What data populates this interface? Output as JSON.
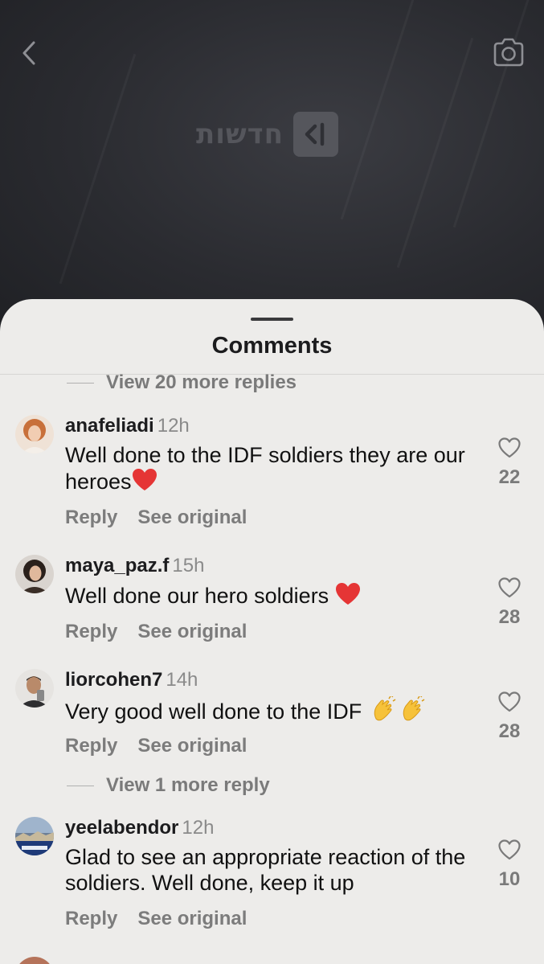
{
  "sheet": {
    "title": "Comments",
    "view_more_top": "View 20 more replies",
    "view_more_mid": "View 1 more reply"
  },
  "logo": {
    "text": "חדשות"
  },
  "colors": {
    "sheet_bg": "#edecea",
    "heart_red": "#e53535",
    "video_bg": "#2b2c31"
  },
  "icons": {
    "back": "chevron-left-icon",
    "camera": "camera-icon",
    "like": "heart-outline-icon"
  },
  "comments": [
    {
      "username": "anafeliadi",
      "time": "12h",
      "text": "Well done to the IDF soldiers they are our heroes",
      "likes": "22",
      "reply": "Reply",
      "see_original": "See original"
    },
    {
      "username": "maya_paz.f",
      "time": "15h",
      "text": "Well done our hero soldiers ",
      "likes": "28",
      "reply": "Reply",
      "see_original": "See original"
    },
    {
      "username": "liorcohen7",
      "time": "14h",
      "text": "Very good well done to the IDF ",
      "likes": "28",
      "reply": "Reply",
      "see_original": "See original"
    },
    {
      "username": "yeelabendor",
      "time": "12h",
      "text": "Glad to see an appropriate reaction of the soldiers. Well done, keep it up",
      "likes": "10",
      "reply": "Reply",
      "see_original": "See original"
    }
  ]
}
